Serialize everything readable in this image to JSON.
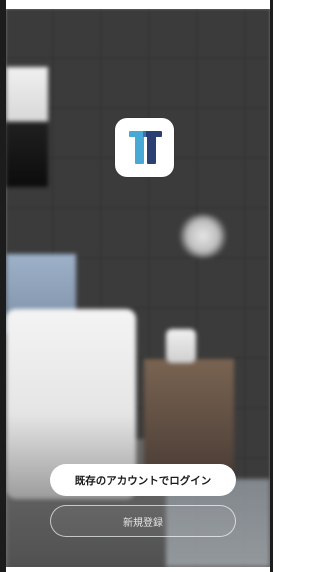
{
  "app": {
    "logo_icon": "app-logo-t",
    "accent_colors": {
      "logo_light": "#48a9d6",
      "logo_dark": "#2c3f73"
    }
  },
  "auth": {
    "login_existing_label": "既存のアカウントでログイン",
    "register_label": "新規登録"
  }
}
